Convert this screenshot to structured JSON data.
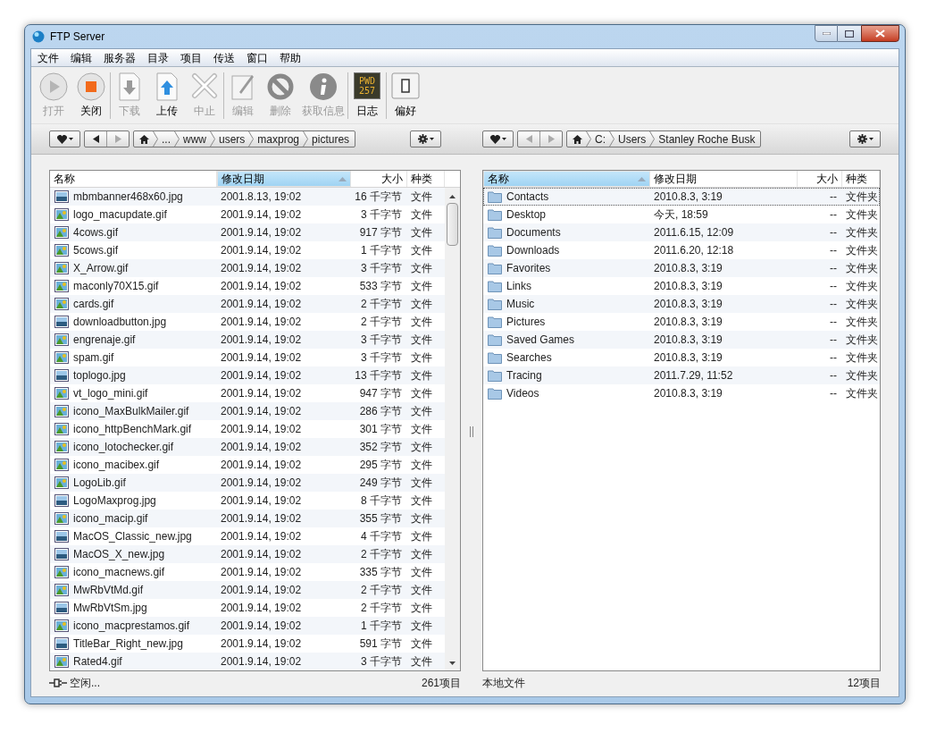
{
  "window": {
    "title": "FTP Server"
  },
  "menu": [
    "文件",
    "编辑",
    "服务器",
    "目录",
    "项目",
    "传送",
    "窗口",
    "帮助"
  ],
  "toolbar": [
    [
      {
        "kind": "play",
        "label": "打开",
        "disabled": true
      },
      {
        "kind": "stop",
        "label": "关闭",
        "disabled": false
      }
    ],
    [
      {
        "kind": "download",
        "label": "下载",
        "disabled": true
      },
      {
        "kind": "upload",
        "label": "上传",
        "disabled": false
      },
      {
        "kind": "cancel",
        "label": "中止",
        "disabled": true
      }
    ],
    [
      {
        "kind": "edit",
        "label": "编辑",
        "disabled": true
      },
      {
        "kind": "delete",
        "label": "删除",
        "disabled": true
      },
      {
        "kind": "info",
        "label": "获取信息",
        "disabled": true
      }
    ],
    [
      {
        "kind": "log",
        "label": "日志",
        "disabled": false,
        "screen_text": [
          "PWD",
          "257"
        ]
      }
    ],
    [
      {
        "kind": "prefs",
        "label": "偏好",
        "disabled": false
      }
    ]
  ],
  "panes": [
    {
      "nav": {
        "back_disabled": false,
        "forward_disabled": true
      },
      "path": [
        "...",
        "www",
        "users",
        "maxprog",
        "pictures"
      ],
      "columns": [
        {
          "label": "名称",
          "selected": false
        },
        {
          "label": "修改日期",
          "selected": true
        },
        {
          "label": "大小",
          "selected": false
        },
        {
          "label": "种类",
          "selected": false
        }
      ],
      "scrollbar": true,
      "rows": [
        {
          "kind": "jpg",
          "name": "mbmbanner468x60.jpg",
          "date": "2001.8.13, 19:02",
          "size": "16 千字节",
          "type": "文件",
          "focused": false
        },
        {
          "kind": "gif",
          "name": "logo_macupdate.gif",
          "date": "2001.9.14, 19:02",
          "size": "3 千字节",
          "type": "文件",
          "focused": false
        },
        {
          "kind": "gif",
          "name": "4cows.gif",
          "date": "2001.9.14, 19:02",
          "size": "917 字节",
          "type": "文件",
          "focused": false
        },
        {
          "kind": "gif",
          "name": "5cows.gif",
          "date": "2001.9.14, 19:02",
          "size": "1 千字节",
          "type": "文件",
          "focused": false
        },
        {
          "kind": "gif",
          "name": "X_Arrow.gif",
          "date": "2001.9.14, 19:02",
          "size": "3 千字节",
          "type": "文件",
          "focused": false
        },
        {
          "kind": "gif",
          "name": "maconly70X15.gif",
          "date": "2001.9.14, 19:02",
          "size": "533 字节",
          "type": "文件",
          "focused": false
        },
        {
          "kind": "gif",
          "name": "cards.gif",
          "date": "2001.9.14, 19:02",
          "size": "2 千字节",
          "type": "文件",
          "focused": false
        },
        {
          "kind": "jpg",
          "name": "downloadbutton.jpg",
          "date": "2001.9.14, 19:02",
          "size": "2 千字节",
          "type": "文件",
          "focused": false
        },
        {
          "kind": "gif",
          "name": "engrenaje.gif",
          "date": "2001.9.14, 19:02",
          "size": "3 千字节",
          "type": "文件",
          "focused": false
        },
        {
          "kind": "gif",
          "name": "spam.gif",
          "date": "2001.9.14, 19:02",
          "size": "3 千字节",
          "type": "文件",
          "focused": false
        },
        {
          "kind": "jpg",
          "name": "toplogo.jpg",
          "date": "2001.9.14, 19:02",
          "size": "13 千字节",
          "type": "文件",
          "focused": false
        },
        {
          "kind": "gif",
          "name": "vt_logo_mini.gif",
          "date": "2001.9.14, 19:02",
          "size": "947 字节",
          "type": "文件",
          "focused": false
        },
        {
          "kind": "gif",
          "name": "icono_MaxBulkMailer.gif",
          "date": "2001.9.14, 19:02",
          "size": "286 字节",
          "type": "文件",
          "focused": false
        },
        {
          "kind": "gif",
          "name": "icono_httpBenchMark.gif",
          "date": "2001.9.14, 19:02",
          "size": "301 字节",
          "type": "文件",
          "focused": false
        },
        {
          "kind": "gif",
          "name": "icono_lotochecker.gif",
          "date": "2001.9.14, 19:02",
          "size": "352 字节",
          "type": "文件",
          "focused": false
        },
        {
          "kind": "gif",
          "name": "icono_macibex.gif",
          "date": "2001.9.14, 19:02",
          "size": "295 字节",
          "type": "文件",
          "focused": false
        },
        {
          "kind": "gif",
          "name": "LogoLib.gif",
          "date": "2001.9.14, 19:02",
          "size": "249 字节",
          "type": "文件",
          "focused": false
        },
        {
          "kind": "jpg",
          "name": "LogoMaxprog.jpg",
          "date": "2001.9.14, 19:02",
          "size": "8 千字节",
          "type": "文件",
          "focused": false
        },
        {
          "kind": "gif",
          "name": "icono_macip.gif",
          "date": "2001.9.14, 19:02",
          "size": "355 字节",
          "type": "文件",
          "focused": false
        },
        {
          "kind": "jpg",
          "name": "MacOS_Classic_new.jpg",
          "date": "2001.9.14, 19:02",
          "size": "4 千字节",
          "type": "文件",
          "focused": false
        },
        {
          "kind": "jpg",
          "name": "MacOS_X_new.jpg",
          "date": "2001.9.14, 19:02",
          "size": "2 千字节",
          "type": "文件",
          "focused": false
        },
        {
          "kind": "gif",
          "name": "icono_macnews.gif",
          "date": "2001.9.14, 19:02",
          "size": "335 字节",
          "type": "文件",
          "focused": false
        },
        {
          "kind": "gif",
          "name": "MwRbVtMd.gif",
          "date": "2001.9.14, 19:02",
          "size": "2 千字节",
          "type": "文件",
          "focused": false
        },
        {
          "kind": "jpg",
          "name": "MwRbVtSm.jpg",
          "date": "2001.9.14, 19:02",
          "size": "2 千字节",
          "type": "文件",
          "focused": false
        },
        {
          "kind": "gif",
          "name": "icono_macprestamos.gif",
          "date": "2001.9.14, 19:02",
          "size": "1 千字节",
          "type": "文件",
          "focused": false
        },
        {
          "kind": "jpg",
          "name": "TitleBar_Right_new.jpg",
          "date": "2001.9.14, 19:02",
          "size": "591 字节",
          "type": "文件",
          "focused": false
        },
        {
          "kind": "gif",
          "name": "Rated4.gif",
          "date": "2001.9.14, 19:02",
          "size": "3 千字节",
          "type": "文件",
          "focused": false
        }
      ],
      "status": {
        "kind": "connection",
        "left": "空闲...",
        "right": "261项目"
      }
    },
    {
      "nav": {
        "back_disabled": true,
        "forward_disabled": true
      },
      "path": [
        "C:",
        "Users",
        "Stanley Roche Busk"
      ],
      "columns": [
        {
          "label": "名称",
          "selected": true
        },
        {
          "label": "修改日期",
          "selected": false
        },
        {
          "label": "大小",
          "selected": false
        },
        {
          "label": "种类",
          "selected": false
        }
      ],
      "scrollbar": false,
      "rows": [
        {
          "kind": "folder",
          "name": "Contacts",
          "date": "2010.8.3, 3:19",
          "size": "--",
          "type": "文件夹",
          "focused": true
        },
        {
          "kind": "folder",
          "name": "Desktop",
          "date": "今天, 18:59",
          "size": "--",
          "type": "文件夹",
          "focused": false
        },
        {
          "kind": "folder",
          "name": "Documents",
          "date": "2011.6.15, 12:09",
          "size": "--",
          "type": "文件夹",
          "focused": false
        },
        {
          "kind": "folder",
          "name": "Downloads",
          "date": "2011.6.20, 12:18",
          "size": "--",
          "type": "文件夹",
          "focused": false
        },
        {
          "kind": "folder",
          "name": "Favorites",
          "date": "2010.8.3, 3:19",
          "size": "--",
          "type": "文件夹",
          "focused": false
        },
        {
          "kind": "folder",
          "name": "Links",
          "date": "2010.8.3, 3:19",
          "size": "--",
          "type": "文件夹",
          "focused": false
        },
        {
          "kind": "folder",
          "name": "Music",
          "date": "2010.8.3, 3:19",
          "size": "--",
          "type": "文件夹",
          "focused": false
        },
        {
          "kind": "folder",
          "name": "Pictures",
          "date": "2010.8.3, 3:19",
          "size": "--",
          "type": "文件夹",
          "focused": false
        },
        {
          "kind": "folder",
          "name": "Saved Games",
          "date": "2010.8.3, 3:19",
          "size": "--",
          "type": "文件夹",
          "focused": false
        },
        {
          "kind": "folder",
          "name": "Searches",
          "date": "2010.8.3, 3:19",
          "size": "--",
          "type": "文件夹",
          "focused": false
        },
        {
          "kind": "folder",
          "name": "Tracing",
          "date": "2011.7.29, 11:52",
          "size": "--",
          "type": "文件夹",
          "focused": false
        },
        {
          "kind": "folder",
          "name": "Videos",
          "date": "2010.8.3, 3:19",
          "size": "--",
          "type": "文件夹",
          "focused": false
        }
      ],
      "status": {
        "kind": "local",
        "left": "本地文件",
        "right": "12项目"
      }
    }
  ]
}
